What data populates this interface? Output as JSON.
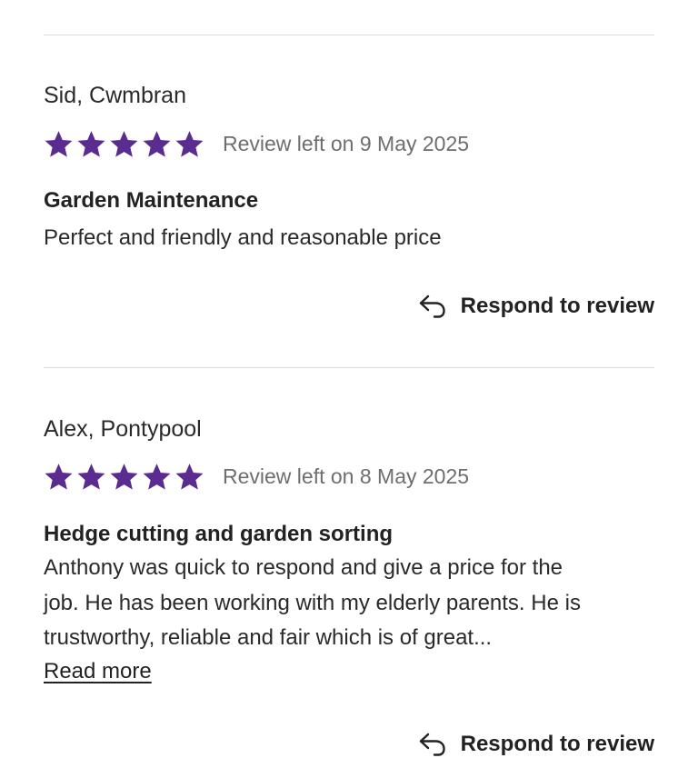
{
  "colors": {
    "star": "#5B2C8F",
    "divider": "#dcdcdc",
    "muted_text": "#6e6e6e",
    "text": "#222222"
  },
  "reviews": [
    {
      "reviewer": "Sid, Cwmbran",
      "rating": 5,
      "max_rating": 5,
      "date_text": "Review left on 9 May 2025",
      "title": "Garden Maintenance",
      "body": "Perfect and friendly and reasonable price",
      "respond_label": "Respond to review",
      "respond_icon": "reply-arrow-icon"
    },
    {
      "reviewer": "Alex, Pontypool",
      "rating": 5,
      "max_rating": 5,
      "date_text": "Review left on 8 May 2025",
      "title": "Hedge cutting and garden sorting",
      "body_lines": [
        "Anthony was quick to respond and give a price for the",
        "job. He has been working with my elderly parents. He is",
        "trustworthy, reliable and fair which is of great..."
      ],
      "read_more_label": "Read more",
      "respond_label": "Respond to review",
      "respond_icon": "reply-arrow-icon"
    }
  ]
}
